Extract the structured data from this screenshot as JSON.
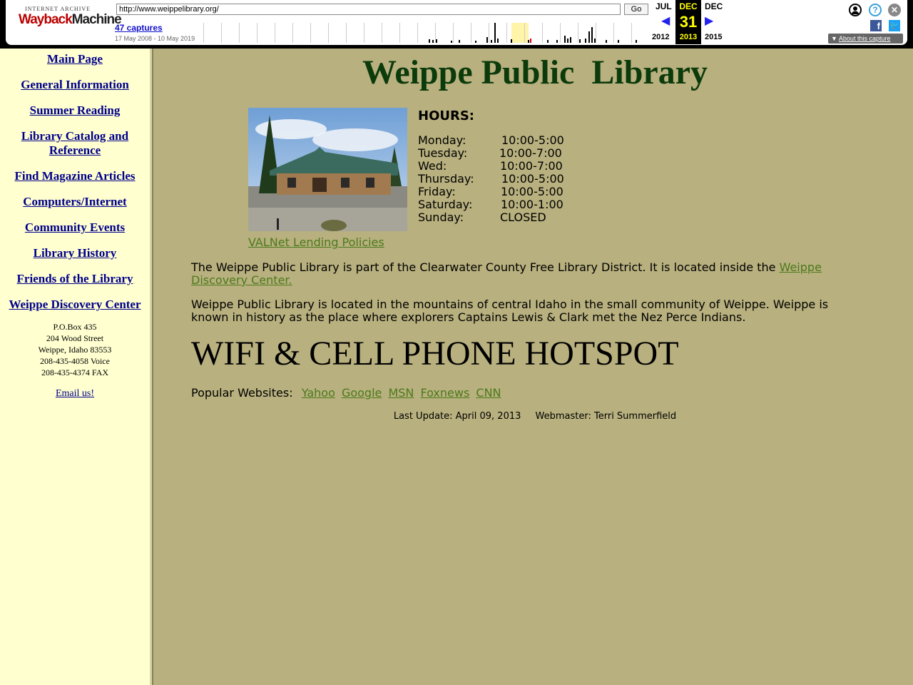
{
  "wayback": {
    "logo_top": "INTERNET ARCHIVE",
    "logo_bottom_a": "Wayback",
    "logo_bottom_b": "Machine",
    "url": "http://www.weippelibrary.org/",
    "go_label": "Go",
    "captures": "47 captures",
    "range": "17 May 2008 - 10 May 2019",
    "prev_month": "JUL",
    "prev_year": "2012",
    "cur_month": "DEC",
    "cur_day": "31",
    "cur_year": "2013",
    "next_month": "DEC",
    "next_year": "2015",
    "about": "About this capture",
    "icons": [
      "user-icon",
      "help-icon",
      "close-icon",
      "facebook-icon",
      "twitter-icon"
    ]
  },
  "sidebar": {
    "nav": [
      "Main Page",
      "General Information",
      "Summer Reading",
      "Library Catalog and Reference",
      "Find Magazine Articles",
      "Computers/Internet",
      "Community Events",
      "Library History",
      "Friends of the Library",
      "Weippe Discovery Center"
    ],
    "address": [
      "P.O.Box 435",
      "204 Wood Street",
      "Weippe, Idaho 83553",
      "208-435-4058 Voice",
      "208-435-4374 FAX"
    ],
    "email": "Email us!"
  },
  "main": {
    "title": "Weippe Public  Library",
    "policies_link": "VALNet Lending Policies",
    "hours_title": "HOURS:",
    "hours": [
      {
        "day": "Monday:",
        "time": "10:00-5:00"
      },
      {
        "day": "Tuesday:",
        "time": "10:00-7:00"
      },
      {
        "day": "Wed:",
        "time": "10:00-7:00"
      },
      {
        "day": "Thursday:",
        "time": "10:00-5:00"
      },
      {
        "day": "Friday:",
        "time": "10:00-5:00"
      },
      {
        "day": "Saturday:",
        "time": "10:00-1:00"
      },
      {
        "day": "Sunday:",
        "time": "CLOSED"
      }
    ],
    "para1_text": "The Weippe Public Library is part of the Clearwater County Free Library District.  It is located inside the ",
    "para1_link": "Weippe Discovery Center.",
    "para2": "Weippe Public Library is located in the mountains of central Idaho in the small community of Weippe. Weippe is known in history as the place where explorers Captains Lewis & Clark met the Nez Perce Indians.",
    "wifi": "WIFI & CELL PHONE HOTSPOT",
    "popular_label": "Popular Websites:",
    "popular_links": [
      "Yahoo",
      "Google",
      "MSN",
      "Foxnews",
      "CNN"
    ],
    "last_update": "Last Update: April 09, 2013",
    "webmaster": "Webmaster: Terri Summerfield"
  },
  "colors": {
    "page_bg": "#b8b07e",
    "sidebar_bg": "#ffffd0",
    "nav_link": "#00008b",
    "content_link": "#4b7a1c",
    "title": "#0b3a0b"
  }
}
